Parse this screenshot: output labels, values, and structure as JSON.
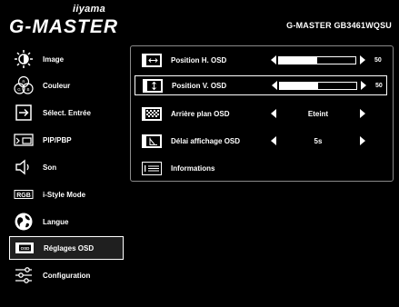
{
  "header": {
    "brand": "iiyama",
    "logo_text": "G-MASTER",
    "model": "G-MASTER GB3461WQSU"
  },
  "sidebar": {
    "items": [
      {
        "label": "Image",
        "icon": "brightness-icon"
      },
      {
        "label": "Couleur",
        "icon": "rgb-color-icon"
      },
      {
        "label": "Sélect. Entrée",
        "icon": "input-select-icon"
      },
      {
        "label": "PIP/PBP",
        "icon": "pip-pbp-icon"
      },
      {
        "label": "Son",
        "icon": "speaker-icon"
      },
      {
        "label": "i-Style Mode",
        "icon": "rgb-badge-icon",
        "badge": "RGB"
      },
      {
        "label": "Langue",
        "icon": "globe-icon"
      },
      {
        "label": "Réglages OSD",
        "icon": "osd-icon",
        "badge": "OSD",
        "selected": true
      },
      {
        "label": "Configuration",
        "icon": "sliders-icon"
      }
    ]
  },
  "main": {
    "rows": [
      {
        "label": "Position H. OSD",
        "icon": "h-position-icon",
        "type": "slider",
        "value": 50,
        "level": 0.5
      },
      {
        "label": "Position V. OSD",
        "icon": "v-position-icon",
        "type": "slider",
        "value": 50,
        "level": 0.5,
        "selected": true
      },
      {
        "label": "Arrière plan OSD",
        "icon": "osd-background-icon",
        "type": "choice",
        "value": "Eteint"
      },
      {
        "label": "Délai affichage OSD",
        "icon": "osd-timeout-icon",
        "type": "choice",
        "value": "5s"
      },
      {
        "label": "Informations",
        "icon": "information-icon",
        "type": "info"
      }
    ]
  }
}
